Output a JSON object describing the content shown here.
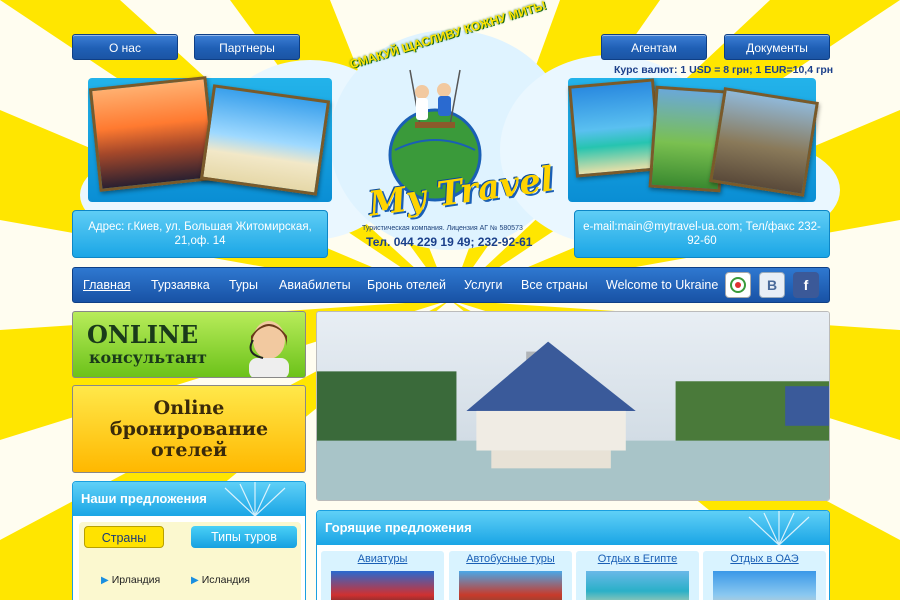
{
  "top_buttons": {
    "about": "О нас",
    "partners": "Партнеры",
    "agents": "Агентам",
    "documents": "Документы"
  },
  "exchange_rate": "Курс валют: 1 USD = 8 грн; 1 EUR=10,4 грн",
  "header": {
    "slogan": "СМАКУЙ ЩАСЛИВУ КОЖНУ МИТЬ!",
    "brand": "My Travel",
    "license": "Туристическая компания. Лицензия АГ № 580573",
    "phone": "Тел. 044 229 19 49; 232-92-61",
    "address": "Адрес: г.Киев, ул. Большая Житомирская, 21,оф. 14",
    "contacts": "e-mail:main@mytravel-ua.com; Тел/факс 232-92-60"
  },
  "nav": {
    "items": [
      "Главная",
      "Турзаявка",
      "Туры",
      "Авиабилеты",
      "Бронь отелей",
      "Услуги",
      "Все страны",
      "Welcome to Ukraine"
    ],
    "social": [
      "vk",
      "facebook"
    ]
  },
  "banners": {
    "online_consultant_title": "ONLINE",
    "online_consultant_sub": "консультант",
    "hotel_booking_line1": "Online",
    "hotel_booking_line2": "бронирование",
    "hotel_booking_line3": "отелей"
  },
  "offers": {
    "title": "Наши предложения",
    "tab_countries": "Страны",
    "tab_tour_types": "Типы туров",
    "countries": [
      "Ирландия",
      "Исландия"
    ]
  },
  "hot_offers": {
    "title": "Горящие предложения",
    "items": [
      "Авиатуры",
      "Автобусные туры",
      "Отдых в Египте",
      "Отдых в ОАЭ"
    ]
  },
  "colors": {
    "sun_yellow": "#ffe600",
    "nav_blue": "#1f5fb5",
    "sky_blue": "#1aa6e6"
  }
}
